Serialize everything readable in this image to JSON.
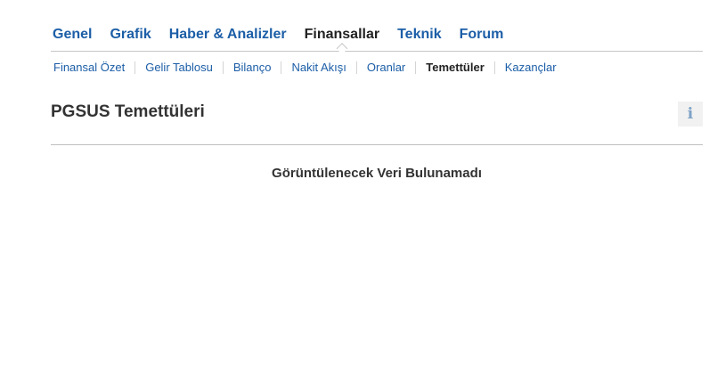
{
  "main_tabs": [
    {
      "label": "Genel"
    },
    {
      "label": "Grafik"
    },
    {
      "label": "Haber & Analizler"
    },
    {
      "label": "Finansallar"
    },
    {
      "label": "Teknik"
    },
    {
      "label": "Forum"
    }
  ],
  "main_active_tab": "Finansallar",
  "sub_tabs": [
    {
      "label": "Finansal Özet"
    },
    {
      "label": "Gelir Tablosu"
    },
    {
      "label": "Bilanço"
    },
    {
      "label": "Nakit Akışı"
    },
    {
      "label": "Oranlar"
    },
    {
      "label": "Temettüler"
    },
    {
      "label": "Kazançlar"
    }
  ],
  "sub_active_tab": "Temettüler",
  "page_title": "PGSUS Temettüleri",
  "info_icon": "i",
  "empty_message": "Görüntülenecek Veri Bulunamadı",
  "colors": {
    "link": "#1c5ea7",
    "active_text": "#222222",
    "info_icon": "#7da2c7"
  }
}
